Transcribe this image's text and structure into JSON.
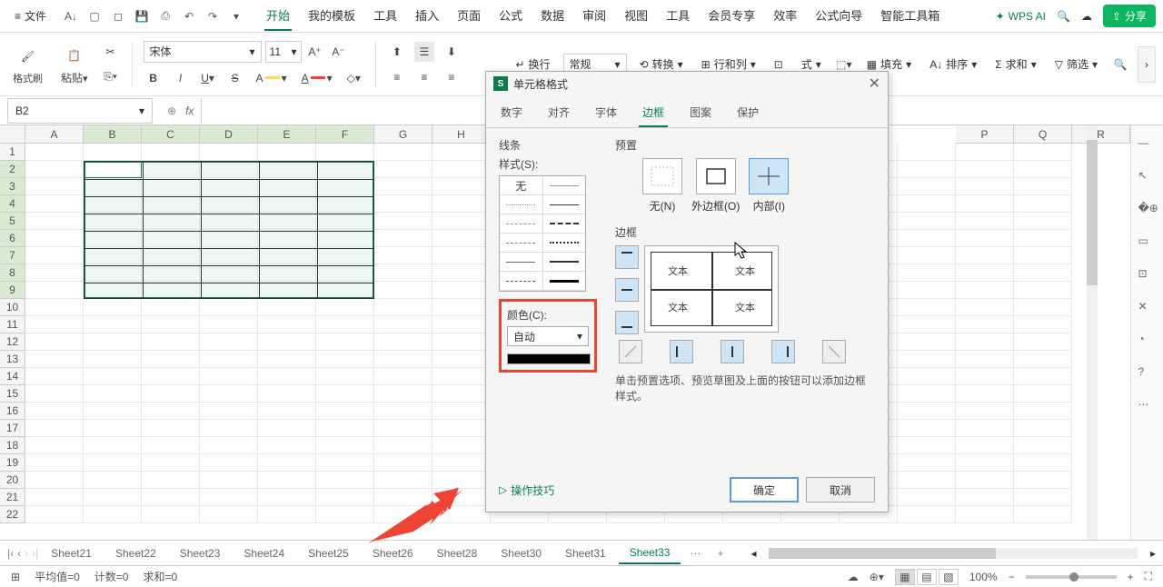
{
  "menubar": {
    "file": "文件",
    "tabs": [
      "开始",
      "我的模板",
      "工具",
      "插入",
      "页面",
      "公式",
      "数据",
      "审阅",
      "视图",
      "工具",
      "会员专享",
      "效率",
      "公式向导",
      "智能工具箱"
    ],
    "active_tab": "开始",
    "wps_ai": "WPS AI",
    "share": "分享"
  },
  "ribbon": {
    "format_painter": "格式刷",
    "paste": "粘贴",
    "font_name": "宋体",
    "font_size": "11",
    "wrap": "换行",
    "number_format": "常规",
    "convert": "转换",
    "rowcol": "行和列",
    "format": "式",
    "fill": "填充",
    "sum": "求和",
    "sort": "排序",
    "filter": "筛选"
  },
  "formula_bar": {
    "cell_ref": "B2"
  },
  "columns": [
    "A",
    "B",
    "C",
    "D",
    "E",
    "F",
    "G",
    "H",
    "P",
    "Q",
    "R"
  ],
  "status": {
    "avg": "平均值=0",
    "count": "计数=0",
    "sum": "求和=0",
    "zoom": "100%"
  },
  "sheets": {
    "tabs": [
      "Sheet21",
      "Sheet22",
      "Sheet23",
      "Sheet24",
      "Sheet25",
      "Sheet26",
      "Sheet28",
      "Sheet30",
      "Sheet31",
      "Sheet33"
    ],
    "active": "Sheet33"
  },
  "dialog": {
    "title": "单元格格式",
    "tabs": [
      "数字",
      "对齐",
      "字体",
      "边框",
      "图案",
      "保护"
    ],
    "active_tab": "边框",
    "line_label": "线条",
    "style_label": "样式(S):",
    "none_label": "无",
    "color_label": "颜色(C):",
    "color_value": "自动",
    "preset_label": "预置",
    "preset_none": "无(N)",
    "preset_outer": "外边框(O)",
    "preset_inner": "内部(I)",
    "border_label": "边框",
    "sample_text": "文本",
    "hint": "单击预置选项、预览草图及上面的按钮可以添加边框样式。",
    "tips": "操作技巧",
    "ok": "确定",
    "cancel": "取消"
  }
}
